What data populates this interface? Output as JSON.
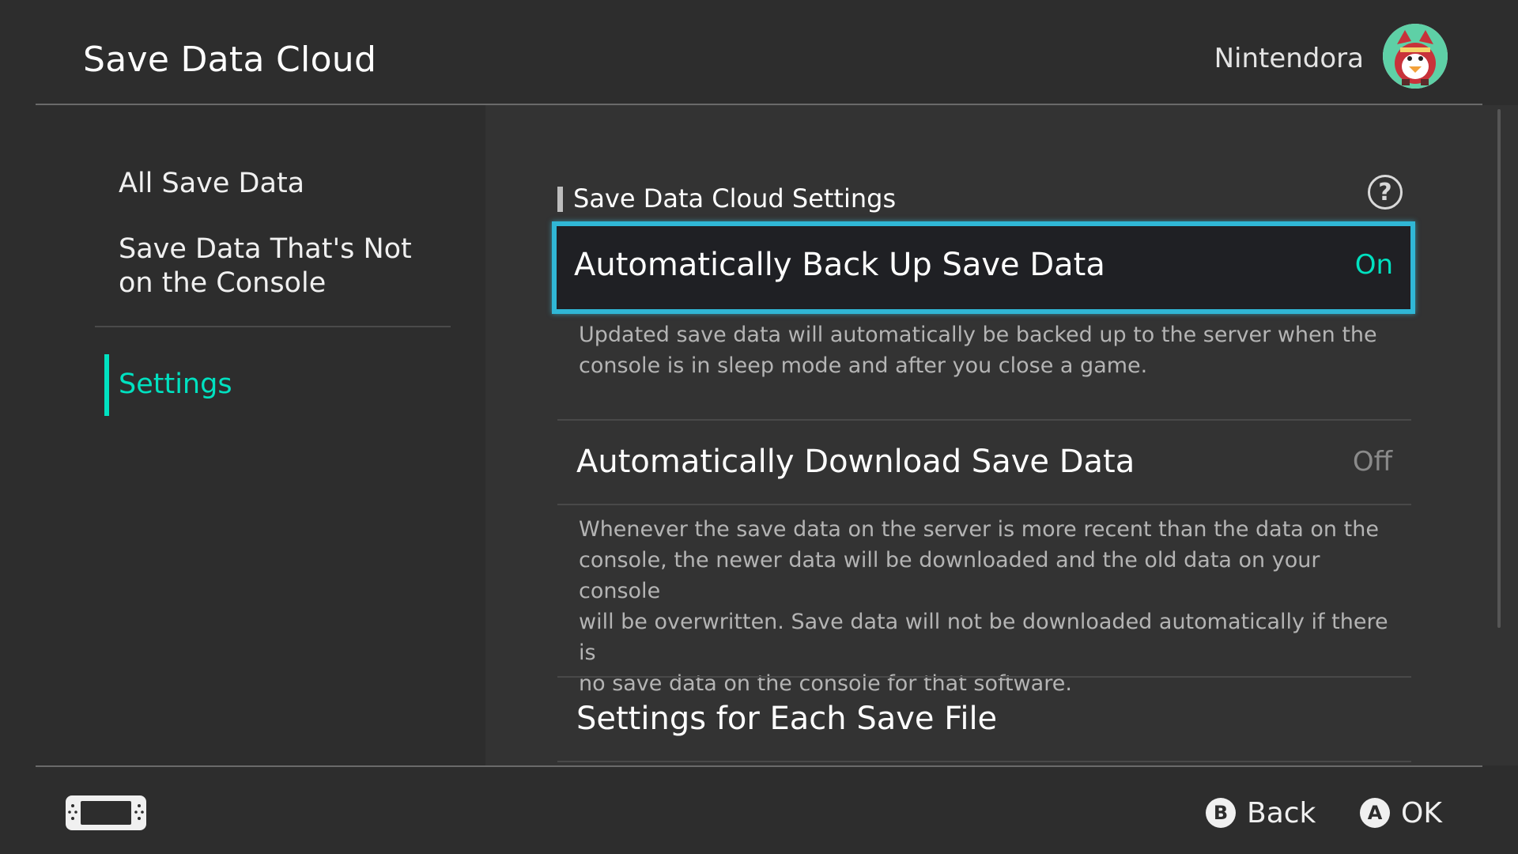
{
  "header": {
    "title": "Save Data Cloud",
    "user_name": "Nintendora"
  },
  "sidebar": {
    "items": [
      {
        "label": "All Save Data",
        "selected": false
      },
      {
        "label_line1": "Save Data That's Not",
        "label_line2": "on the Console",
        "selected": false
      },
      {
        "label": "Settings",
        "selected": true
      }
    ]
  },
  "main": {
    "section_title": "Save Data Cloud Settings",
    "settings": [
      {
        "label": "Automatically Back Up Save Data",
        "value": "On",
        "focused": true,
        "description_line1": "Updated save data will automatically be backed up to the server when the",
        "description_line2": "console is in sleep mode and after you close a game."
      },
      {
        "label": "Automatically Download Save Data",
        "value": "Off",
        "focused": false,
        "description_line1": "Whenever the save data on the server is more recent than the data on the",
        "description_line2": "console, the newer data will be downloaded and the old data on your console",
        "description_line3": "will be overwritten. Save data will not be downloaded automatically if there is",
        "description_line4": "no save data on the console for that software."
      },
      {
        "label": "Settings for Each Save File"
      }
    ]
  },
  "footer": {
    "back_glyph": "B",
    "back_label": "Back",
    "ok_glyph": "A",
    "ok_label": "OK"
  },
  "colors": {
    "background": "#2d2d2d",
    "accent_teal": "#00e1c0",
    "focus_border": "#30b7d6",
    "off_gray": "#8a8a8a"
  },
  "icons": {
    "help": "question-circle-icon",
    "console": "handheld-console-icon",
    "avatar": "villager-avatar"
  }
}
